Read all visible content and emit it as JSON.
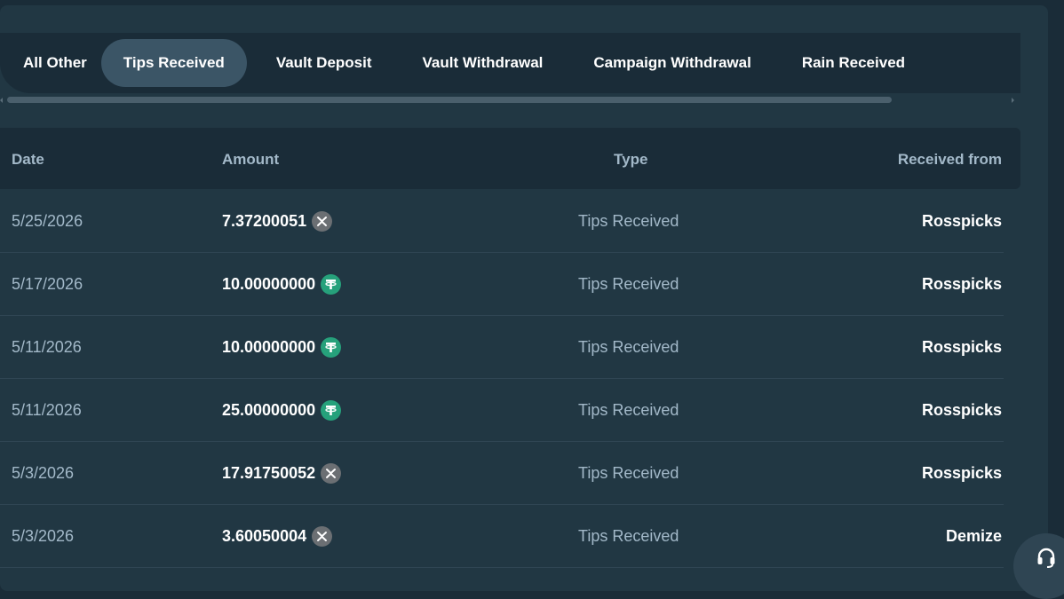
{
  "tabs": [
    {
      "label": "All Other",
      "active": false
    },
    {
      "label": "Tips Received",
      "active": true
    },
    {
      "label": "Vault Deposit",
      "active": false
    },
    {
      "label": "Vault Withdrawal",
      "active": false
    },
    {
      "label": "Campaign Withdrawal",
      "active": false
    },
    {
      "label": "Rain Received",
      "active": false
    }
  ],
  "table": {
    "headers": {
      "date": "Date",
      "amount": "Amount",
      "type": "Type",
      "from": "Received from"
    },
    "rows": [
      {
        "date": "5/25/2026",
        "amount": "7.37200051",
        "currency_icon": "xrp-icon",
        "type": "Tips Received",
        "from": "Rosspicks"
      },
      {
        "date": "5/17/2026",
        "amount": "10.00000000",
        "currency_icon": "usdt-icon",
        "type": "Tips Received",
        "from": "Rosspicks"
      },
      {
        "date": "5/11/2026",
        "amount": "10.00000000",
        "currency_icon": "usdt-icon",
        "type": "Tips Received",
        "from": "Rosspicks"
      },
      {
        "date": "5/11/2026",
        "amount": "25.00000000",
        "currency_icon": "usdt-icon",
        "type": "Tips Received",
        "from": "Rosspicks"
      },
      {
        "date": "5/3/2026",
        "amount": "17.91750052",
        "currency_icon": "xrp-icon",
        "type": "Tips Received",
        "from": "Rosspicks"
      },
      {
        "date": "5/3/2026",
        "amount": "3.60050004",
        "currency_icon": "xrp-icon",
        "type": "Tips Received",
        "from": "Demize"
      }
    ]
  },
  "support_button_icon": "headset-icon",
  "colors": {
    "background": "#1a2c38",
    "panel": "#213743",
    "active_tab": "#3b5566",
    "muted_text": "#a3b9c9",
    "usdt": "#26a17b",
    "xrp": "#6b6f73"
  }
}
